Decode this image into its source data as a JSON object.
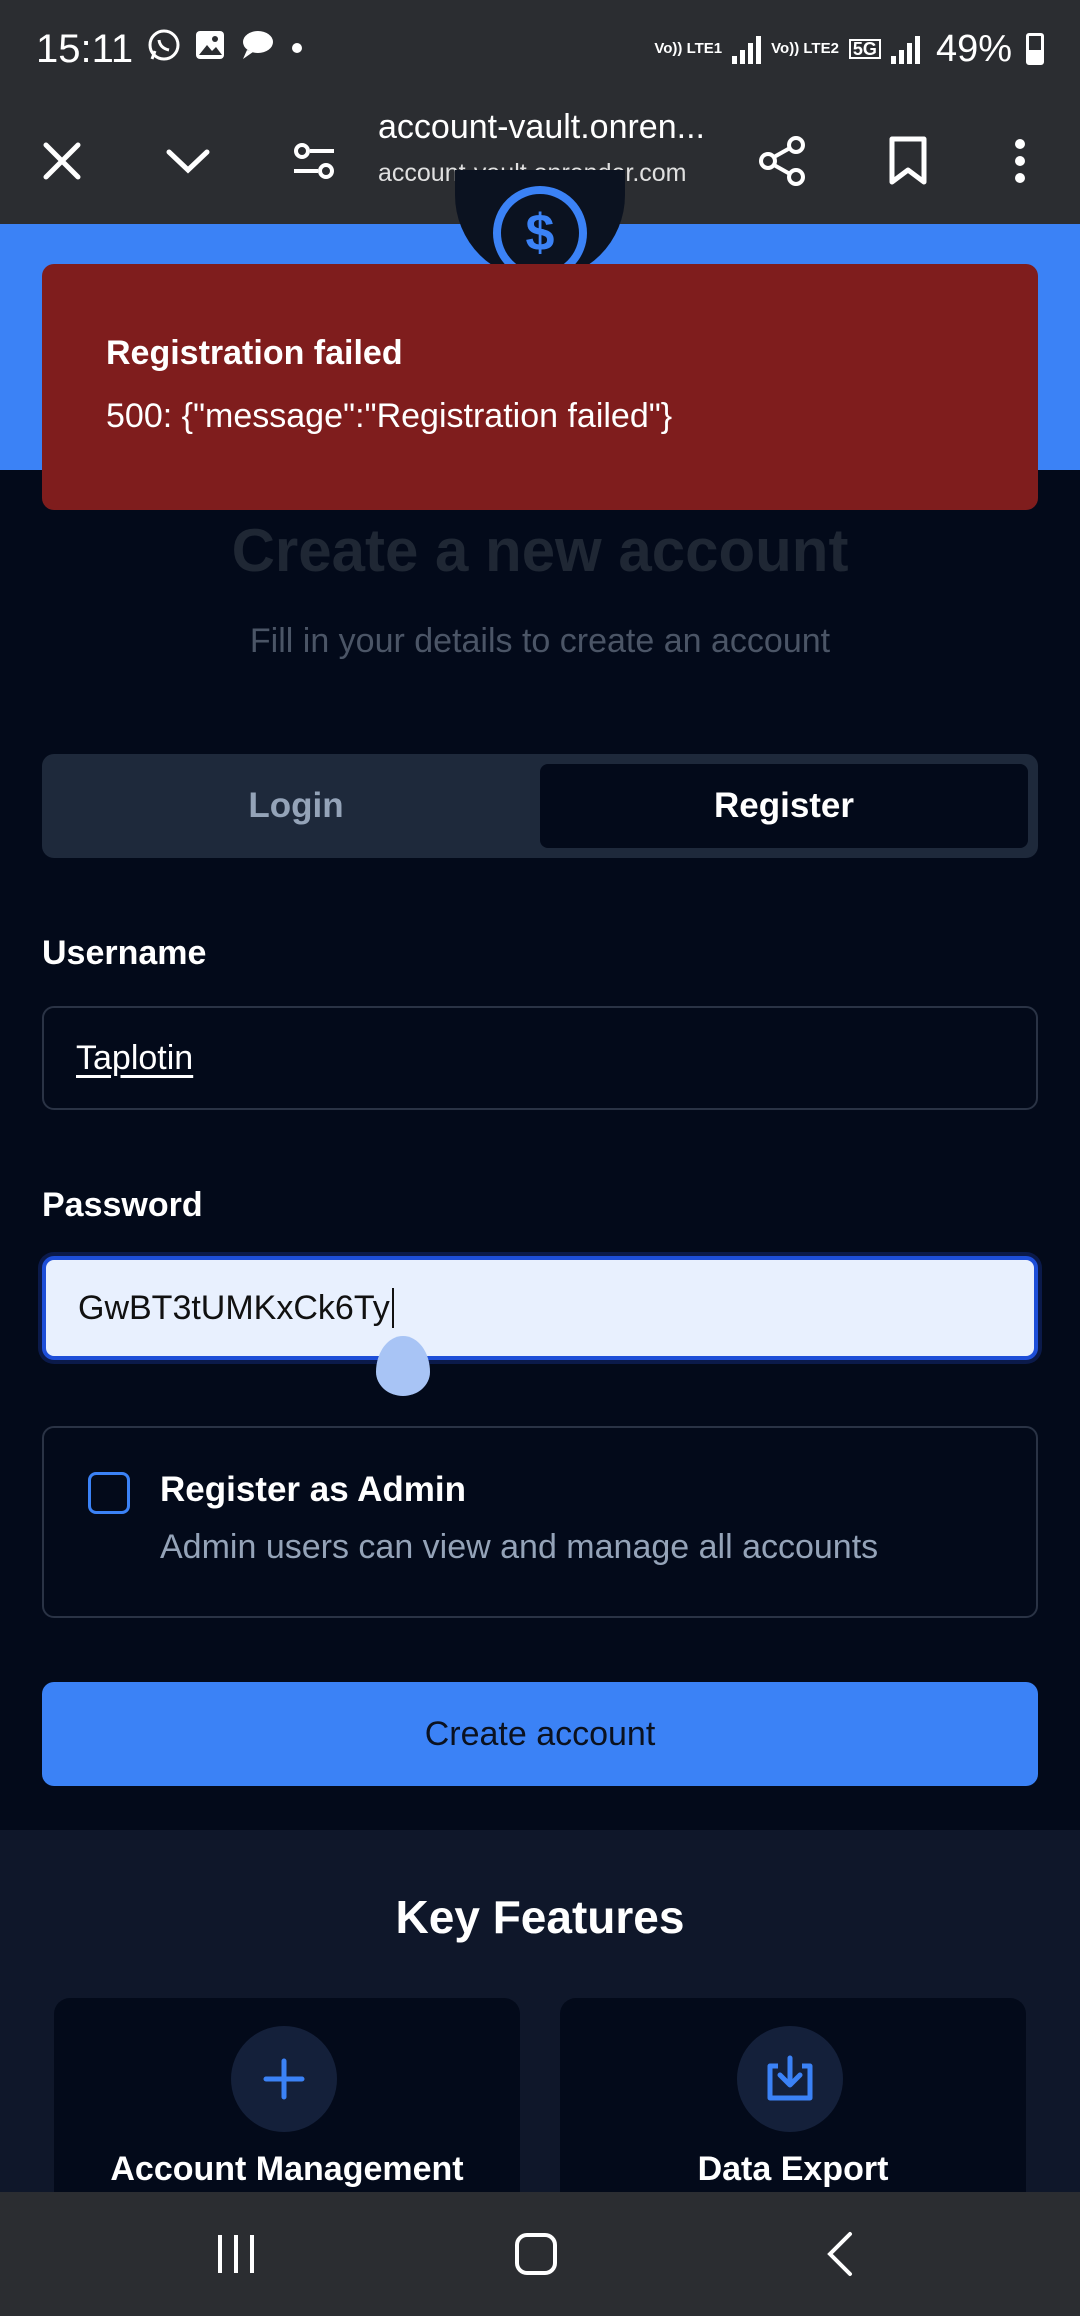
{
  "status_bar": {
    "time": "15:11",
    "left_icons": [
      "whatsapp-icon",
      "gallery-icon",
      "message-icon",
      "dot-icon"
    ],
    "net1": "Vo)) LTE1",
    "net2": "Vo)) LTE2",
    "net_5g": "5G",
    "battery": "49%"
  },
  "browser": {
    "url_title": "account-vault.onren...",
    "url_sub": "account-vault.onrender.com"
  },
  "toast": {
    "title": "Registration failed",
    "message": "500: {\"message\":\"Registration failed\"}",
    "color": "#7f1d1d"
  },
  "page": {
    "heading": "Create a new account",
    "subtitle": "Fill in your details to create an account"
  },
  "tabs": [
    {
      "label": "Login",
      "active": false
    },
    {
      "label": "Register",
      "active": true
    }
  ],
  "form": {
    "username_label": "Username",
    "username_value": "Taplotin",
    "password_label": "Password",
    "password_value": "GwBT3tUMKxCk6Ty",
    "admin_title": "Register as Admin",
    "admin_desc": "Admin users can view and manage all accounts",
    "submit": "Create account"
  },
  "features": {
    "title": "Key Features",
    "items": [
      {
        "label": "Account Management",
        "icon": "plus-icon"
      },
      {
        "label": "Data Export",
        "icon": "download-icon"
      }
    ]
  },
  "colors": {
    "accent": "#3b82f6",
    "background": "#030a1a",
    "error": "#7f1d1d"
  }
}
